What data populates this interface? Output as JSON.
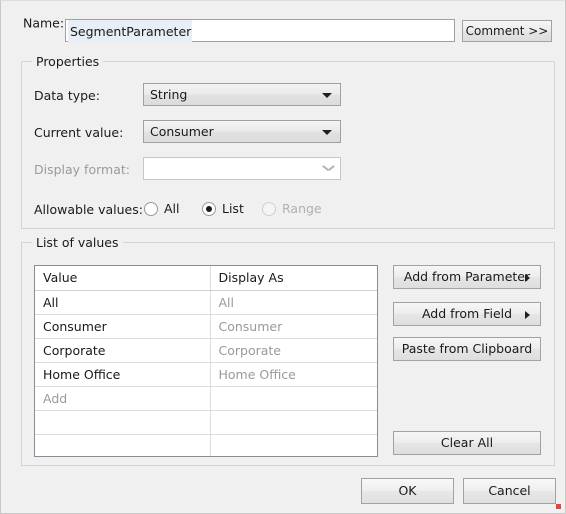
{
  "dialog": {
    "name_label": "Name:",
    "name_value": "SegmentParameter",
    "comment_button": "Comment >>"
  },
  "properties": {
    "title": "Properties",
    "data_type": {
      "label": "Data type:",
      "value": "String"
    },
    "current_value": {
      "label": "Current value:",
      "value": "Consumer"
    },
    "display_format": {
      "label": "Display format:",
      "value": ""
    },
    "allowable_values": {
      "label": "Allowable values:",
      "options": [
        {
          "label": "All",
          "checked": false,
          "disabled": false
        },
        {
          "label": "List",
          "checked": true,
          "disabled": false
        },
        {
          "label": "Range",
          "checked": false,
          "disabled": true
        }
      ]
    }
  },
  "list_of_values": {
    "title": "List of values",
    "columns": [
      "Value",
      "Display As"
    ],
    "rows": [
      {
        "value": "All",
        "display_as": "All",
        "placeholder": false
      },
      {
        "value": "Consumer",
        "display_as": "Consumer",
        "placeholder": false
      },
      {
        "value": "Corporate",
        "display_as": "Corporate",
        "placeholder": false
      },
      {
        "value": "Home Office",
        "display_as": "Home Office",
        "placeholder": false
      },
      {
        "value": "Add",
        "display_as": "",
        "placeholder": true
      },
      {
        "value": "",
        "display_as": "",
        "placeholder": false
      },
      {
        "value": "",
        "display_as": "",
        "placeholder": false
      }
    ],
    "buttons": {
      "add_from_parameter": "Add from Parameter",
      "add_from_field": "Add from Field",
      "paste_from_clipboard": "Paste from Clipboard",
      "clear_all": "Clear All"
    }
  },
  "footer": {
    "ok": "OK",
    "cancel": "Cancel"
  },
  "colors": {
    "dialog_background": "#f0f0f0",
    "field_background": "#ffffff",
    "border": "#a0a0a0",
    "muted_text": "#9a9a9a",
    "text": "#1a1a1a",
    "selection": "#e8eef5",
    "marker": "#e8443a"
  }
}
